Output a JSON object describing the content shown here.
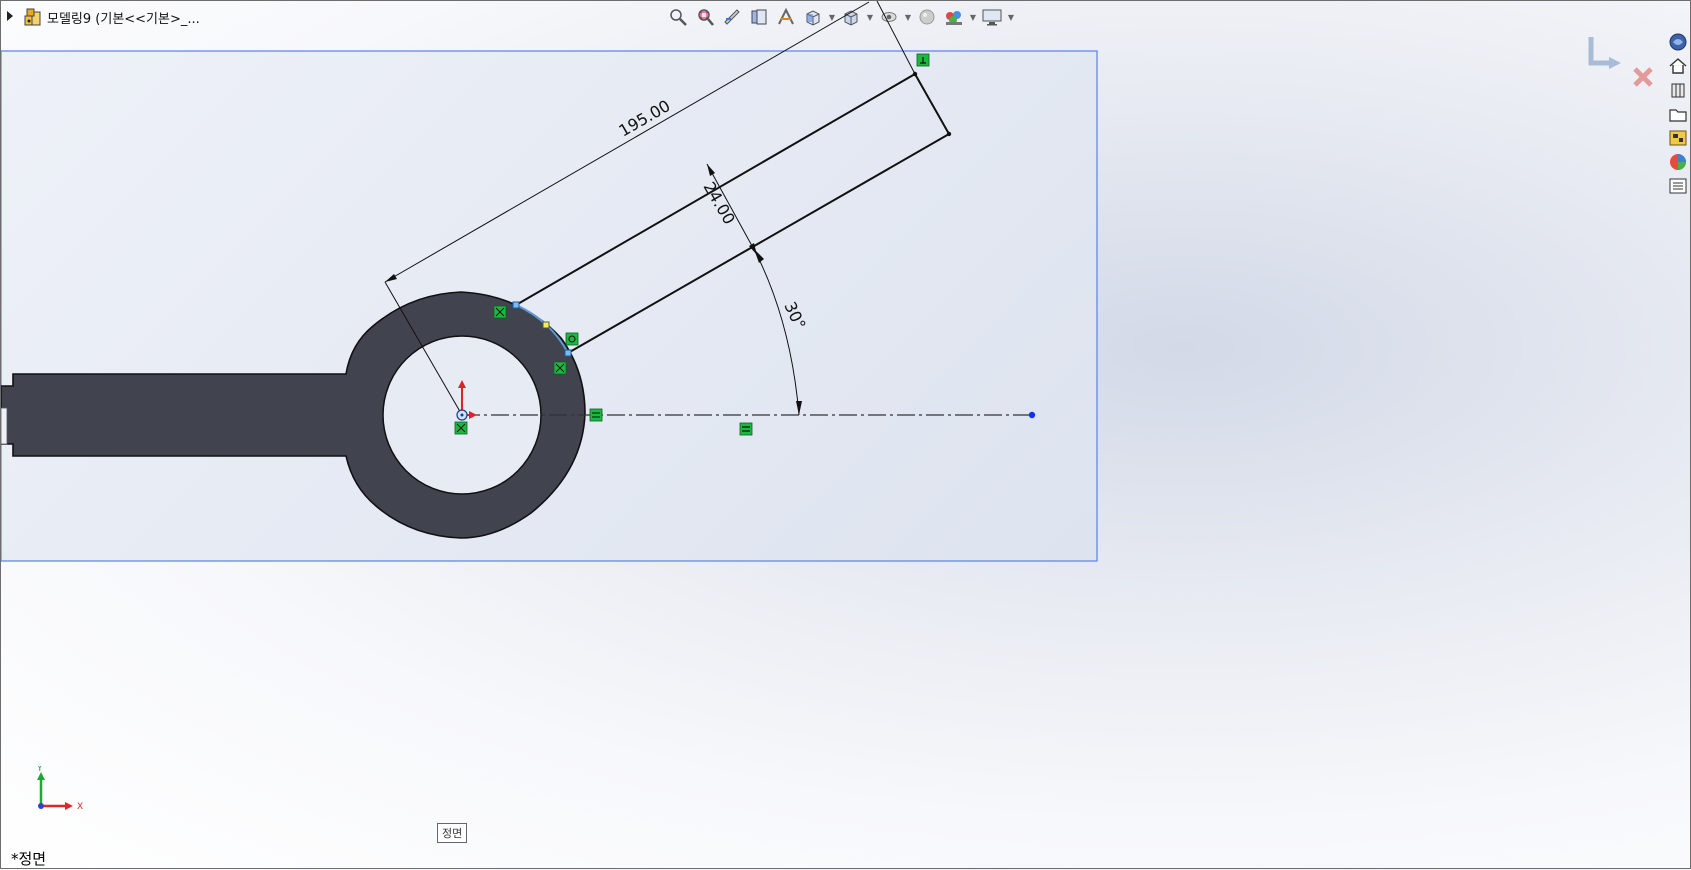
{
  "document": {
    "title": "모델링9  (기본<<기본>_..."
  },
  "toolbar": {
    "buttons": [
      "zoom-to-fit-icon",
      "zoom-to-area-icon",
      "previous-view-icon",
      "section-view-icon",
      "dynamic-annotation-icon",
      "view-orientation-icon",
      "display-style-icon",
      "hide-show-items-icon",
      "edit-appearance-icon",
      "apply-scene-icon",
      "view-settings-icon"
    ]
  },
  "dimensions": {
    "length": "195.00",
    "width": "24.00",
    "angle": "30°"
  },
  "triad": {
    "x_label": "X",
    "y_label": "Y"
  },
  "view": {
    "tooltip": "정면",
    "name": "*정면"
  },
  "colors": {
    "part_fill": "#41444f",
    "selection_border": "#5b7ff0",
    "relation_green": "#1bb940",
    "accent_red": "#e0212b",
    "endpoint_blue": "#1032f0"
  },
  "task_pane": {
    "items": [
      "solidworks-resources-icon",
      "home-icon",
      "design-library-icon",
      "file-explorer-icon",
      "view-palette-icon",
      "appearances-icon",
      "custom-properties-icon"
    ]
  }
}
